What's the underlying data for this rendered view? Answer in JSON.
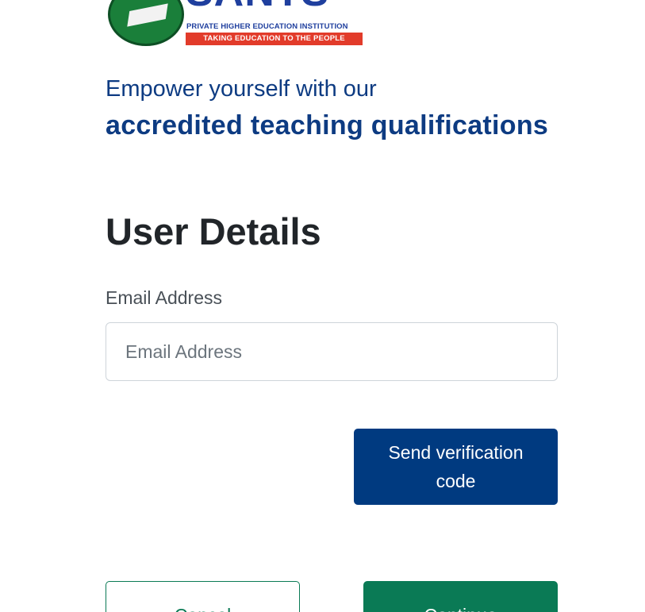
{
  "logo": {
    "brand": "SANTS",
    "subtitle": "PRIVATE HIGHER EDUCATION INSTITUTION",
    "tagline": "TAKING EDUCATION TO THE PEOPLE"
  },
  "hero": {
    "line1": "Empower yourself with our",
    "line2": "accredited teaching qualifications"
  },
  "form": {
    "title": "User Details",
    "email_label": "Email Address",
    "email_placeholder": "Email Address",
    "email_value": "",
    "send_code_label": "Send verification code",
    "cancel_label": "Cancel",
    "continue_label": "Continue"
  },
  "colors": {
    "brand_blue": "#0d3b82",
    "button_blue": "#003a80",
    "accent_green": "#0a7a55",
    "logo_red": "#e23b2a"
  }
}
